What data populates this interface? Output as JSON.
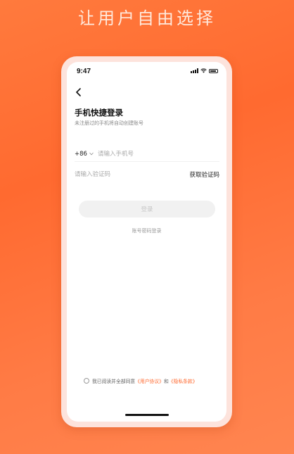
{
  "headline": "让用户自由选择",
  "status_bar": {
    "time": "9:47"
  },
  "login": {
    "title": "手机快捷登录",
    "subtitle": "未注册过的手机将自动创建账号",
    "country_code": "+86",
    "phone_placeholder": "请输入手机号",
    "code_placeholder": "请输入验证码",
    "get_code_label": "获取验证码",
    "login_button_label": "登录",
    "password_login_label": "账号密码登录"
  },
  "agreement": {
    "prefix": "我已阅读并全部同意",
    "user_agreement": "《用户协议》",
    "connector": "和",
    "privacy_policy": "《隐私条款》"
  },
  "colors": {
    "accent": "#ff6a30",
    "background": "#ff7236"
  }
}
